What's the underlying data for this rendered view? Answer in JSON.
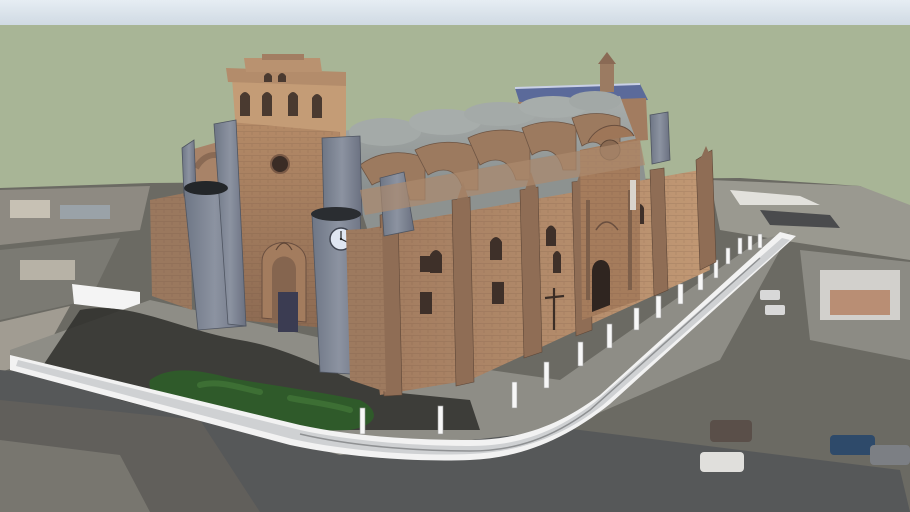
{
  "colors": {
    "sky_top": "#dfe8f0",
    "sky_bottom": "#d0dbe6",
    "ground": "#a9b596",
    "stone_light": "#b28a6a",
    "stone_mid": "#9a7358",
    "stone_dark": "#6f5444",
    "slate": "#7e8593",
    "roof_gray": "#9ca3a3",
    "asphalt": "#525456",
    "sidewalk": "#b9bbbd",
    "curb": "#f0f0f0",
    "shadow": "#2d2d2b",
    "tree": "#2f5a2a",
    "clock_face": "#dfe6f2"
  },
  "icons": {
    "cross": "cross-icon",
    "clock": "clock-icon"
  }
}
